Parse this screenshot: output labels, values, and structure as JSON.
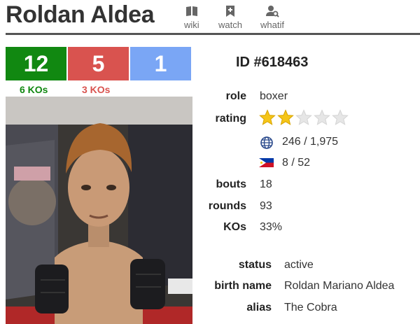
{
  "header": {
    "name": "Roldan Aldea",
    "links": [
      {
        "label": "wiki",
        "icon": "book-icon"
      },
      {
        "label": "watch",
        "icon": "bookmark-icon"
      },
      {
        "label": "whatif",
        "icon": "user-search-icon"
      }
    ]
  },
  "record": {
    "wins": "12",
    "losses": "5",
    "draws": "1",
    "win_kos": "6 KOs",
    "loss_kos": "3 KOs",
    "colors": {
      "win": "#118811",
      "loss": "#d9534f",
      "draw": "#7aa6f5"
    }
  },
  "profile": {
    "id": "ID #618463",
    "role_label": "role",
    "role": "boxer",
    "rating_label": "rating",
    "rating_stars": 2,
    "rating_max": 5,
    "world_rank": "246 / 1,975",
    "country_rank": "8 / 52",
    "bouts_label": "bouts",
    "bouts": "18",
    "rounds_label": "rounds",
    "rounds": "93",
    "kos_label": "KOs",
    "kos": "33%",
    "status_label": "status",
    "status": "active",
    "birth_name_label": "birth name",
    "birth_name": "Roldan Mariano Aldea",
    "alias_label": "alias",
    "alias": "The Cobra"
  }
}
